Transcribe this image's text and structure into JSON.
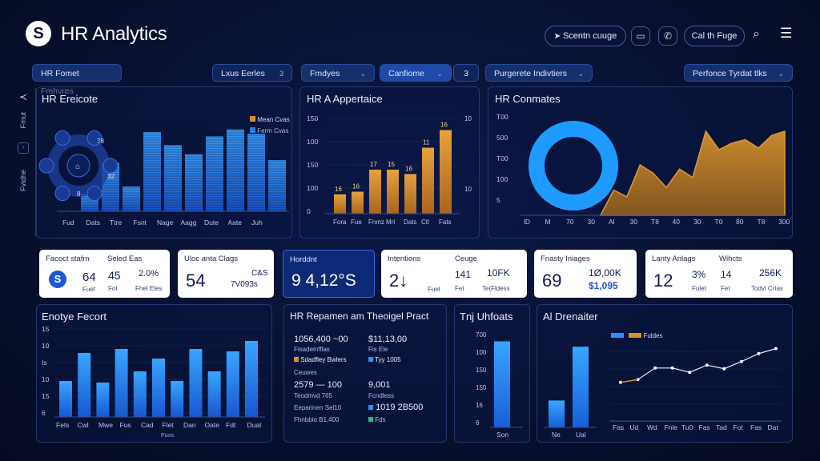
{
  "header": {
    "logo_letter": "S",
    "title": "HR Analytics",
    "search_btn": "Scentn cuuge",
    "call_btn": "Cal th Fuge",
    "icons": [
      "send-icon",
      "monitor-icon",
      "phone-icon",
      "search-icon",
      "menu-icon"
    ]
  },
  "filters": {
    "f1": "HR Fomet Fmhvres",
    "f2": "Lxus Eerles",
    "f2_num": "3",
    "f3": "Fmdyes",
    "f4": "Canfiome",
    "f4_num": "3",
    "f5": "Purgerete Indivtiers",
    "f6": "Perfonce Tyrdat tlks"
  },
  "side": {
    "top": "Fmut",
    "bottom": "Fvidhe"
  },
  "panel1": {
    "title": "HR Ereicote",
    "legend": [
      "Mean Cvas",
      "Ferm Cvas"
    ],
    "ring_labels": [
      "78",
      "32",
      "8"
    ],
    "chart_data": {
      "type": "bar",
      "categories": [
        "Fud",
        "Dats",
        "Ttre",
        "Fsnt",
        "Nage",
        "Aagg",
        "Dute",
        "Aate",
        "Juh"
      ],
      "values": [
        20,
        55,
        28,
        90,
        75,
        65,
        85,
        93,
        88,
        58
      ]
    }
  },
  "panel2": {
    "title": "HR A Appertaice",
    "yticks": [
      "150",
      "100",
      "150",
      "100",
      "0"
    ],
    "chart_data": {
      "type": "bar",
      "categories": [
        "Fora",
        "Fue",
        "Fnmz",
        "Mrl",
        "Dats",
        "Ctl",
        "Fats"
      ],
      "values": [
        22,
        25,
        50,
        50,
        45,
        75,
        95
      ],
      "labels": [
        "16",
        "16",
        "17",
        "15",
        "16",
        "11",
        "16"
      ],
      "colors": [
        "#c07a2a",
        "#d4902e"
      ]
    }
  },
  "panel3": {
    "title": "HR Conmates",
    "yticks": [
      "T00",
      "500",
      "T00",
      "100",
      "5"
    ],
    "xticks": [
      "lD",
      "M",
      "70",
      "30",
      "Al",
      "30",
      "T8",
      "40",
      "30",
      "T0",
      "80",
      "T8",
      "300"
    ],
    "chart_data": {
      "type": "area",
      "x": [
        0,
        1,
        2,
        3,
        4,
        5,
        6,
        7,
        8,
        9,
        10,
        11,
        12,
        13,
        14
      ],
      "values": [
        0,
        30,
        22,
        60,
        50,
        33,
        55,
        45,
        100,
        78,
        86,
        90,
        80,
        95,
        100
      ],
      "donut_fill": 1.0
    }
  },
  "cards": [
    {
      "label1": "Facoct stafm",
      "label2": "Seled Eas",
      "icon": "S",
      "v1": "64",
      "v2": "45",
      "sub1": "Fuet",
      "sub2": "Fot",
      "pct": "2.0%",
      "pctsub": "Fhel Eles"
    },
    {
      "label1": "Uloc anta Clags",
      "v1": "54",
      "top": "C&S",
      "sub": "7V093s"
    },
    {
      "label1": "Horddnt",
      "v1": "9 4,12°S"
    },
    {
      "label1": "Intentions",
      "label2": "Ceuge",
      "v1": "2↓",
      "v2": "141",
      "v3": "10FK",
      "s1": "Fuet",
      "s2": "Fet",
      "s3": "Te(Fldess"
    },
    {
      "label1": "Fnasty Iniages",
      "v1": "69",
      "v2": "1Ø,00K",
      "v3": "$1,095"
    },
    {
      "label1": "Lanty Anlags",
      "label2": "Wihcts",
      "v1": "12",
      "v2": "3%",
      "v3": "14",
      "v4": "256K",
      "s1": "Fulet",
      "s2": "Fet",
      "s3": "Todvl Crtas"
    }
  ],
  "panel4": {
    "title": "Enotye Fecort",
    "yticks": [
      "15",
      "10",
      "Is",
      "10",
      "15",
      "6"
    ],
    "xticks": [
      "Fets",
      "Cwl",
      "Mwe",
      "Fus",
      "Cad",
      "Flet",
      "Dan",
      "Oate",
      "Fdt",
      "Duat"
    ],
    "xsub": "Fuxs",
    "chart_data": {
      "type": "bar",
      "values": [
        45,
        80,
        43,
        85,
        57,
        73,
        45,
        85,
        57,
        82,
        95
      ],
      "values2": [
        0,
        0,
        0,
        0,
        0,
        0,
        0,
        0,
        0,
        0,
        0
      ]
    }
  },
  "panel5": {
    "title": "HR Repamen am Theoigel Pract",
    "rows": [
      {
        "a": "1056,400 ~00",
        "b": "$11,13,00",
        "as": "Fisadeinfflas",
        "bs": "Fis Ele"
      },
      {
        "a": "Sdadfley Bwlers",
        "b": "Tyy 1005",
        "as": "",
        "bs": ""
      },
      {
        "a": "Ceuwes",
        "b": "",
        "as": "",
        "bs": ""
      },
      {
        "a": "2579 — 100",
        "b": "9,001",
        "as": "Teodmvd 765",
        "bs": "Fcndless"
      },
      {
        "a": "Eeparinen Sel10",
        "b": "1019 2B500",
        "as": "Fhnbbio B1,400",
        "bs": "Fds"
      }
    ]
  },
  "panel6": {
    "title": "Tnj Uhfoats",
    "yticks": [
      "700",
      "100",
      "150",
      "150",
      "16",
      "6"
    ],
    "xticks": [
      "Son"
    ],
    "chart_data": {
      "type": "bar",
      "values": [
        96
      ]
    }
  },
  "panel7": {
    "title": "Al Drenaiter",
    "bar_yticks": [],
    "bar_xticks": [
      "Ne",
      "Ual"
    ],
    "legend": [
      "",
      "Fuldes"
    ],
    "xticks": [
      "Fas",
      "Ud",
      "Wd",
      "Fnle",
      "Tu0",
      "Fas",
      "Tad",
      "Fot",
      "Fas",
      "Dat"
    ],
    "chart_data": {
      "type": "line",
      "bars": [
        30,
        90
      ],
      "values": [
        48,
        52,
        68,
        68,
        62,
        72,
        67,
        77,
        88,
        95
      ]
    }
  }
}
